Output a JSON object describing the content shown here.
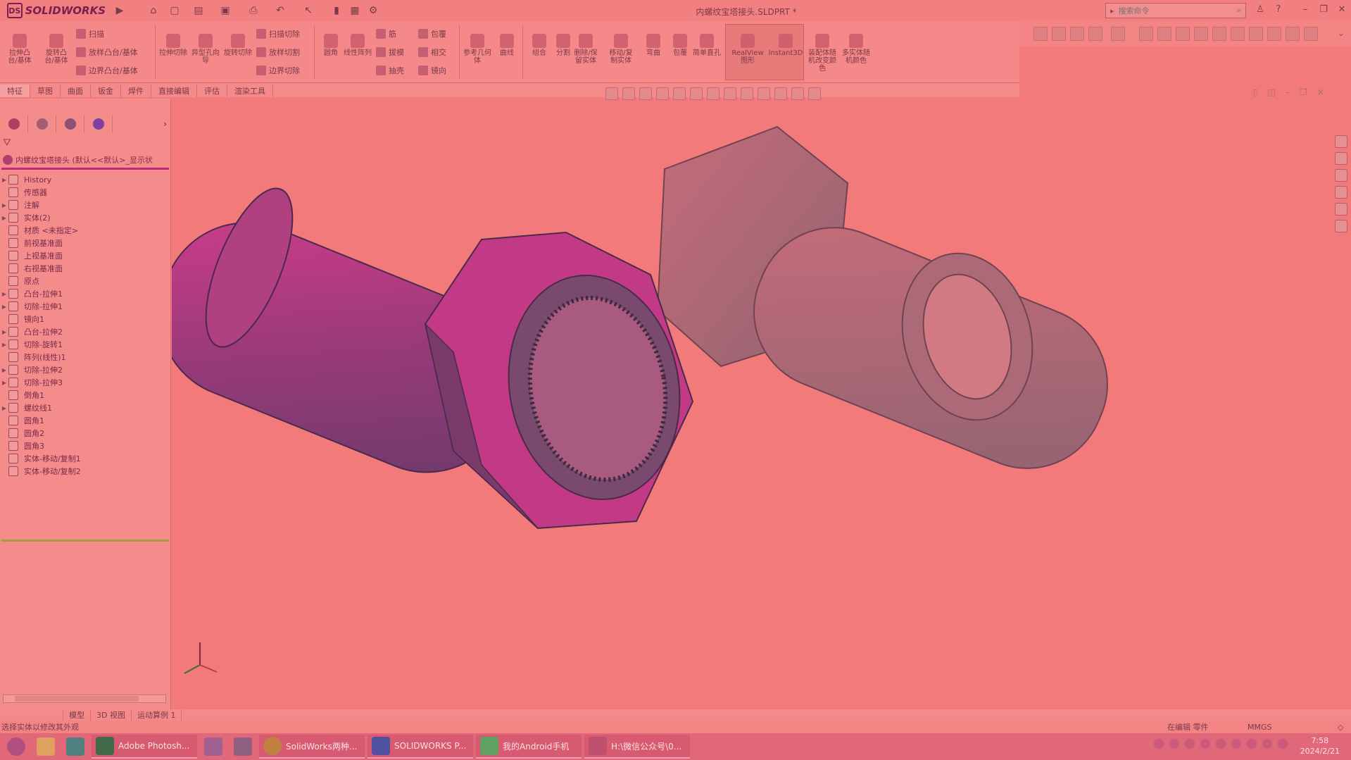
{
  "app": {
    "name": "SOLIDWORKS",
    "doc_title": "内螺纹宝塔接头.SLDPRT *",
    "search_placeholder": "搜索命令"
  },
  "ribbon": {
    "extrude_boss": "拉伸凸台/基体",
    "revolve_boss": "旋转凸台/基体",
    "sweep": "扫描",
    "loft_boss": "放样凸台/基体",
    "boundary_boss": "边界凸台/基体",
    "extrude_cut": "拉伸切除",
    "hole_wizard": "异型孔向导",
    "revolve_cut": "旋转切除",
    "swept_cut": "扫描切除",
    "loft_cut": "放样切割",
    "boundary_cut": "边界切除",
    "fillet": "圆角",
    "linear_pattern": "线性阵列",
    "rib": "筋",
    "draft": "拔模",
    "shell": "抽壳",
    "wrap": "包覆",
    "intersect": "相交",
    "mirror": "镜向",
    "ref_geometry": "参考几何体",
    "curves": "曲线",
    "combine": "组合",
    "split": "分割",
    "delete_keep_body": "删除/保留实体",
    "move_copy_body": "移动/复制实体",
    "flex": "弯曲",
    "wrap2": "包覆",
    "simple_hole": "简单直孔",
    "realview": "RealView图形",
    "instant3d": "Instant3D",
    "assembly_color": "装配体随机改变颜色",
    "multibody_color": "多实体随机颜色"
  },
  "tabs": [
    "特征",
    "草图",
    "曲面",
    "钣金",
    "焊件",
    "直接编辑",
    "评估",
    "渲染工具"
  ],
  "tree": {
    "root": "内螺纹宝塔接头 (默认<<默认>_显示状",
    "items": [
      {
        "label": "History",
        "expandable": true
      },
      {
        "label": "传感器",
        "expandable": false
      },
      {
        "label": "注解",
        "expandable": true
      },
      {
        "label": "实体(2)",
        "expandable": true
      },
      {
        "label": "材质 <未指定>",
        "expandable": false
      },
      {
        "label": "前视基准面",
        "expandable": false
      },
      {
        "label": "上视基准面",
        "expandable": false
      },
      {
        "label": "右视基准面",
        "expandable": false
      },
      {
        "label": "原点",
        "expandable": false
      },
      {
        "label": "凸台-拉伸1",
        "expandable": true
      },
      {
        "label": "切除-拉伸1",
        "expandable": true
      },
      {
        "label": "镜向1",
        "expandable": false
      },
      {
        "label": "凸台-拉伸2",
        "expandable": true
      },
      {
        "label": "切除-旋转1",
        "expandable": true
      },
      {
        "label": "阵列(线性)1",
        "expandable": false
      },
      {
        "label": "切除-拉伸2",
        "expandable": true
      },
      {
        "label": "切除-拉伸3",
        "expandable": true
      },
      {
        "label": "倒角1",
        "expandable": false
      },
      {
        "label": "螺纹线1",
        "expandable": true
      },
      {
        "label": "圆角1",
        "expandable": false
      },
      {
        "label": "圆角2",
        "expandable": false
      },
      {
        "label": "圆角3",
        "expandable": false
      },
      {
        "label": "实体-移动/复制1",
        "expandable": false
      },
      {
        "label": "实体-移动/复制2",
        "expandable": false
      }
    ]
  },
  "bottom_tabs": [
    "模型",
    "3D 视图",
    "运动算例 1"
  ],
  "status": {
    "message": "选择实体以修改其外观",
    "editing": "在编辑 零件",
    "units": "MMGS"
  },
  "taskbar": {
    "apps": [
      {
        "label": "Adobe Photosh..."
      },
      {
        "label": "SolidWorks两种..."
      },
      {
        "label": "SOLIDWORKS P..."
      },
      {
        "label": "我的Android手机"
      },
      {
        "label": "H:\\微信公众号\\0..."
      }
    ],
    "time": "7:58",
    "date": "2024/2/21"
  },
  "colors": {
    "accent": "#c02a7a",
    "background": "#f27a7a"
  }
}
